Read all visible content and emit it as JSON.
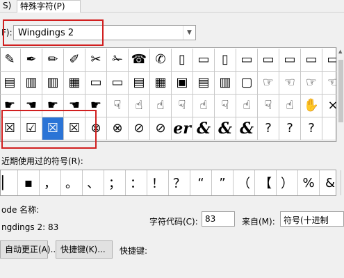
{
  "tabs": [
    {
      "label": "S)"
    },
    {
      "label": "特殊字符(P)"
    }
  ],
  "font": {
    "label": "F):",
    "value": "Wingdings 2"
  },
  "grid": {
    "rows": [
      [
        "✎",
        "✒",
        "✏",
        "✐",
        "✂",
        "✁",
        "☎",
        "✆",
        "▯",
        "▭",
        "▯",
        "▭",
        "▭",
        "▭",
        "▭",
        "▭"
      ],
      [
        "▤",
        "▥",
        "▥",
        "▦",
        "▭",
        "▭",
        "▤",
        "▦",
        "▣",
        "▤",
        "▥",
        "▢",
        "☞",
        "☜",
        "☞",
        "☜"
      ],
      [
        "☛",
        "☚",
        "☛",
        "☚",
        "☛",
        "☟",
        "☝",
        "☝",
        "☟",
        "☝",
        "☟",
        "☝",
        "☟",
        "☝",
        "✋",
        "×"
      ],
      [
        "☒",
        "☑",
        "☒",
        "☒",
        "⊗",
        "⊗",
        "⊘",
        "⊘",
        "er",
        "&",
        "&",
        "&",
        "?",
        "?",
        "?",
        ""
      ]
    ],
    "selected_row": 3,
    "selected_col": 2
  },
  "recent": {
    "label": "近期使用过的符号(R):",
    "symbols": [
      "▏",
      "▪",
      "，",
      "。",
      "、",
      "；",
      "：",
      "！",
      "？",
      "“",
      "”",
      "（",
      "【",
      "）",
      "%",
      "&"
    ]
  },
  "unicode": {
    "label": "ode 名称:",
    "value": "ngdings 2: 83"
  },
  "char_code": {
    "label": "字符代码(C):",
    "value": "83"
  },
  "from": {
    "label": "来自(M):",
    "value": "符号(十进制"
  },
  "buttons": {
    "autocorrect": "自动更正(A)...",
    "shortcut": "快捷键(K)...",
    "shortcut_label": "快捷键:"
  }
}
